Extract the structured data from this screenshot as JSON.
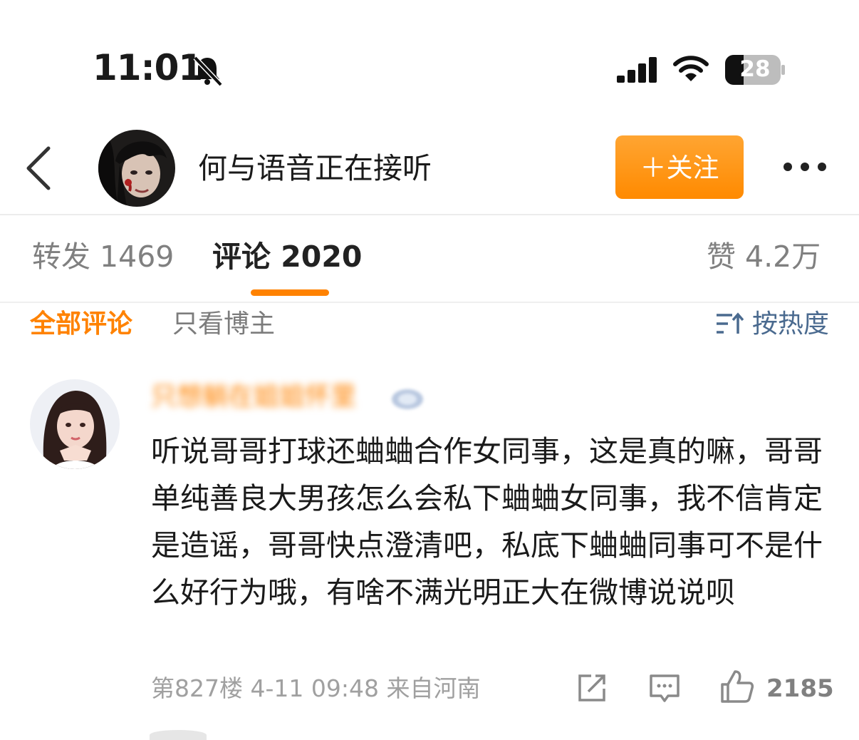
{
  "status_bar": {
    "time": "11:01",
    "battery": "28",
    "icons": [
      "bell-slash-icon",
      "signal-icon",
      "wifi-icon",
      "battery-icon"
    ]
  },
  "header": {
    "title": "何与语音正在接听",
    "follow_label": "＋关注",
    "icons": [
      "back-icon",
      "more-icon"
    ]
  },
  "tabs": [
    {
      "label": "转发 1469"
    },
    {
      "label": "评论 2020"
    },
    {
      "label": "赞 4.2万"
    }
  ],
  "filters": {
    "all": "全部评论",
    "author_only": "只看博主",
    "sort": "按热度"
  },
  "comment": {
    "username": "只想躺在姐姐怀里",
    "text": "听说哥哥打球还蛐蛐合作女同事，这是真的嘛，哥哥单纯善良大男孩怎么会私下蛐蛐女同事，我不信肯定是造谣，哥哥快点澄清吧，私底下蛐蛐同事可不是什么好行为哦，有啥不满光明正大在微博说说呗",
    "meta": "第827楼 4-11 09:48 来自河南",
    "likes": "2185"
  },
  "colors": {
    "accent": "#ff8200",
    "link": "#4a6a8f",
    "muted": "#808080"
  }
}
